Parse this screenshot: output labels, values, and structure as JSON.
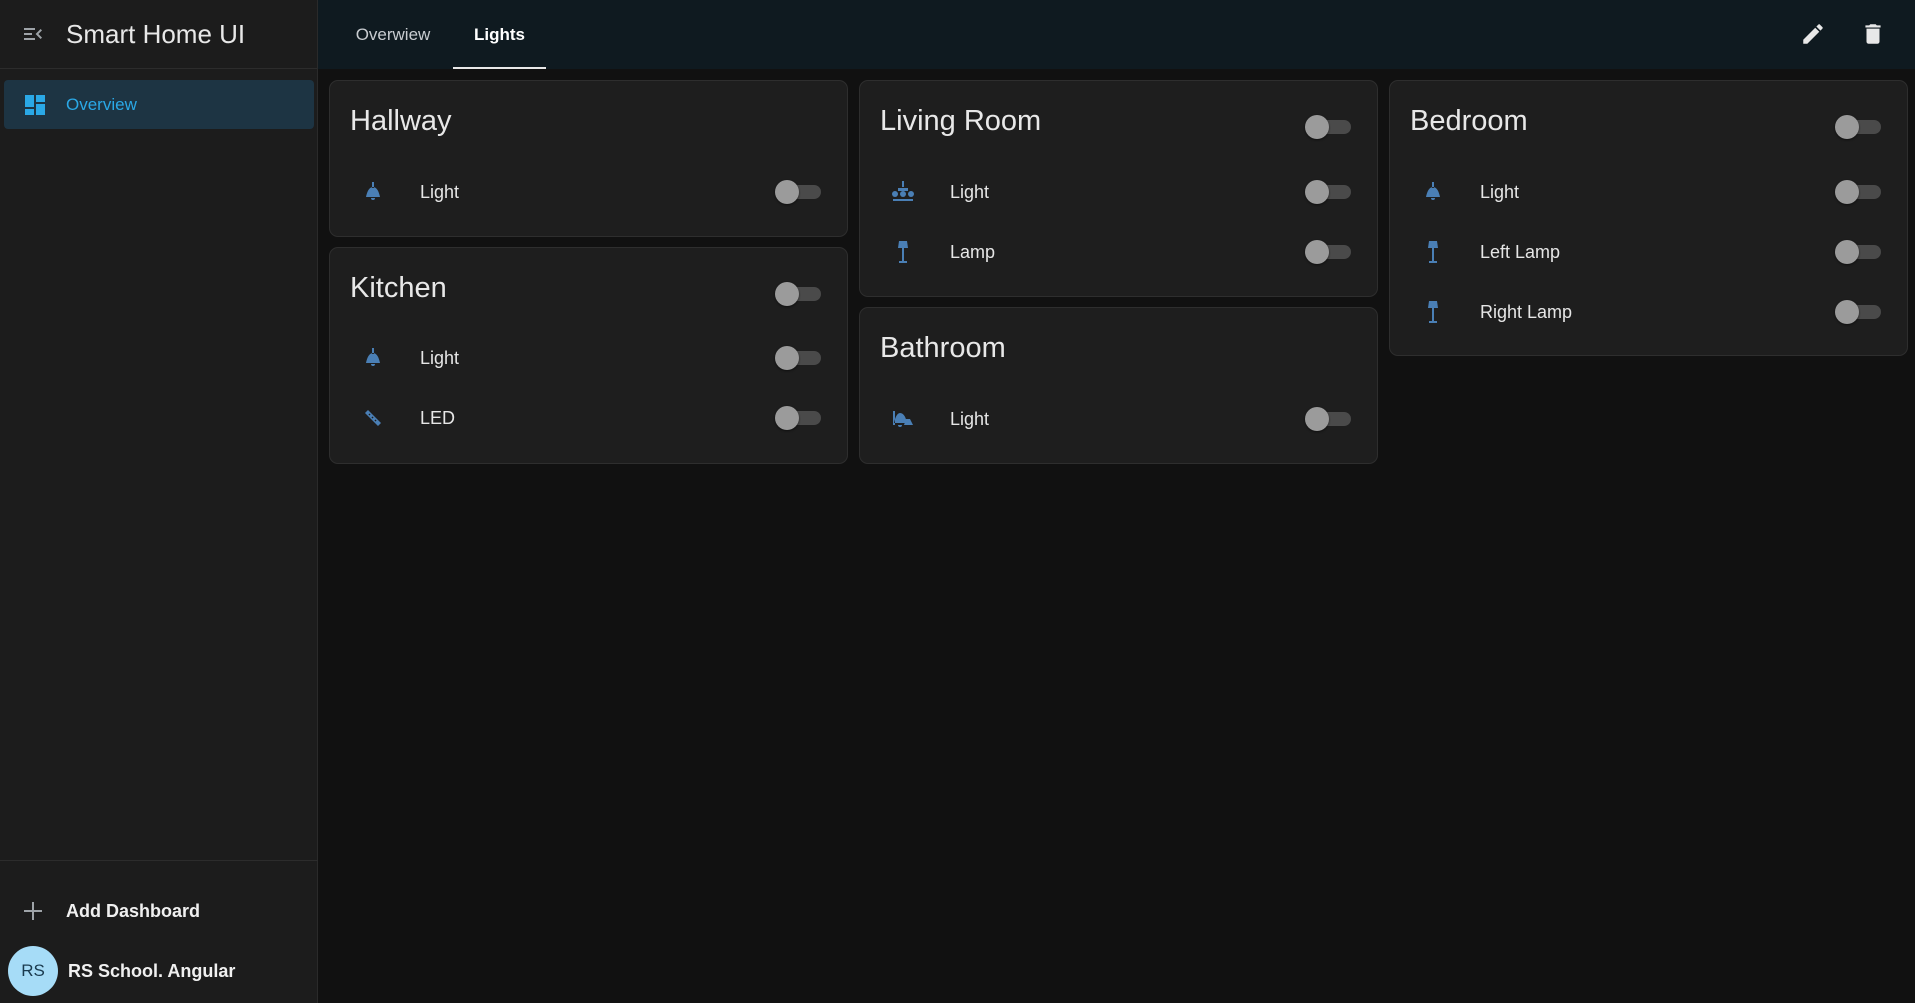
{
  "app": {
    "title": "Smart Home UI"
  },
  "sidebar": {
    "nav": [
      {
        "label": "Overview",
        "icon": "dashboard-icon",
        "active": true
      }
    ],
    "add_dashboard": "Add Dashboard",
    "user": {
      "initials": "RS",
      "name": "RS School. Angular"
    }
  },
  "tabs": [
    {
      "label": "Overwiew",
      "active": false
    },
    {
      "label": "Lights",
      "active": true
    }
  ],
  "toolbar": {
    "edit_icon": "pencil-icon",
    "delete_icon": "trash-icon"
  },
  "colors": {
    "accent": "#2aa8e6",
    "icon_blue": "#4a7fb5",
    "card_bg": "#1e1e1e",
    "background": "#111111",
    "sidebar_bg": "#1c1c1c",
    "topbar_bg": "#0f1a20"
  },
  "rooms": {
    "hallway": {
      "title": "Hallway",
      "devices": [
        {
          "label": "Light",
          "icon": "ceiling-light-icon",
          "on": false
        }
      ]
    },
    "kitchen": {
      "title": "Kitchen",
      "on": false,
      "devices": [
        {
          "label": "Light",
          "icon": "ceiling-light-icon",
          "on": false
        },
        {
          "label": "LED",
          "icon": "led-strip-icon",
          "on": false
        }
      ]
    },
    "living_room": {
      "title": "Living Room",
      "on": false,
      "devices": [
        {
          "label": "Light",
          "icon": "chandelier-icon",
          "on": false
        },
        {
          "label": "Lamp",
          "icon": "floor-lamp-icon",
          "on": false
        }
      ]
    },
    "bathroom": {
      "title": "Bathroom",
      "devices": [
        {
          "label": "Light",
          "icon": "wall-light-icon",
          "on": false
        }
      ]
    },
    "bedroom": {
      "title": "Bedroom",
      "on": false,
      "devices": [
        {
          "label": "Light",
          "icon": "ceiling-light-icon",
          "on": false
        },
        {
          "label": "Left Lamp",
          "icon": "floor-lamp-icon",
          "on": false
        },
        {
          "label": "Right Lamp",
          "icon": "floor-lamp-icon",
          "on": false
        }
      ]
    }
  }
}
